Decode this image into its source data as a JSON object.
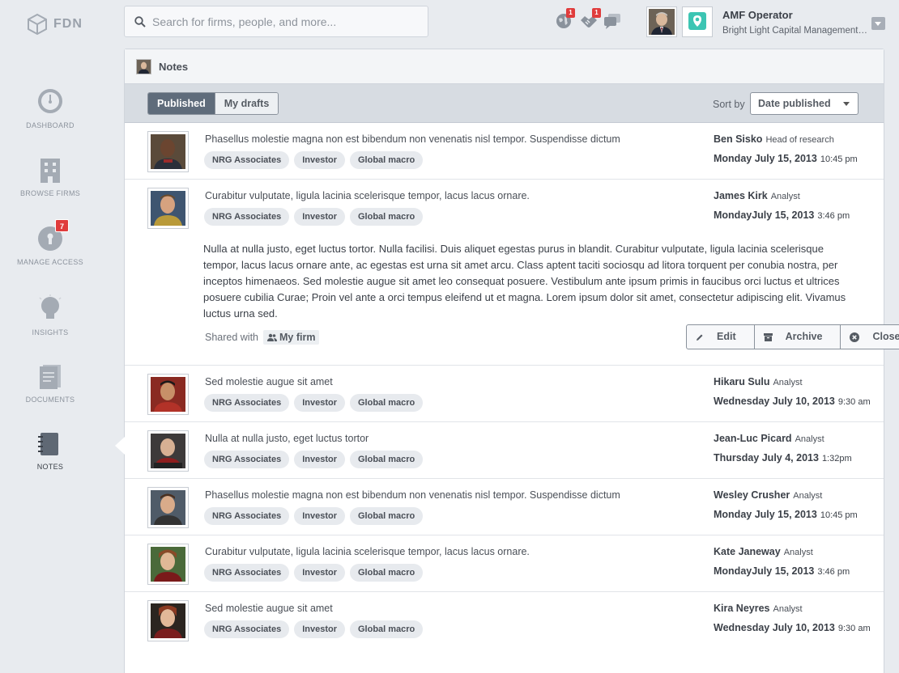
{
  "brand": {
    "name": "FDN"
  },
  "search": {
    "placeholder": "Search for firms, people, and more..."
  },
  "notifications": [
    {
      "icon": "globe-icon",
      "count": "1"
    },
    {
      "icon": "handshake-icon",
      "count": "1"
    },
    {
      "icon": "chat-bubbles-icon"
    }
  ],
  "user": {
    "name": "AMF Operator",
    "firm": "Bright Light Capital Management ..."
  },
  "sidebar": {
    "items": [
      {
        "label": "DASHBOARD",
        "icon": "dashboard-icon"
      },
      {
        "label": "BROWSE FIRMS",
        "icon": "building-icon"
      },
      {
        "label": "MANAGE ACCESS",
        "icon": "lock-icon",
        "badge": "7"
      },
      {
        "label": "INSIGHTS",
        "icon": "lightbulb-icon"
      },
      {
        "label": "DOCUMENTS",
        "icon": "documents-icon"
      },
      {
        "label": "NOTES",
        "icon": "notebook-icon",
        "active": true
      }
    ]
  },
  "panel": {
    "title": "Notes",
    "tabs": {
      "published": "Published",
      "drafts": "My drafts"
    },
    "sort": {
      "label": "Sort by",
      "value": "Date published"
    }
  },
  "tags": [
    "NRG Associates",
    "Investor",
    "Global macro"
  ],
  "notes": [
    {
      "title": "Phasellus molestie magna non est bibendum non venenatis nisl tempor. Suspendisse dictum",
      "author": "Ben Sisko",
      "role": "Head of research",
      "date": "Monday July 15, 2013",
      "time": "10:45 pm"
    },
    {
      "title": "Curabitur vulputate, ligula lacinia scelerisque tempor, lacus lacus ornare.",
      "author": "James Kirk",
      "role": "Analyst",
      "date": "MondayJuly 15, 2013",
      "time": "3:46 pm",
      "body": "Nulla at nulla justo, eget luctus tortor. Nulla facilisi. Duis aliquet egestas purus in blandit. Curabitur vulputate, ligula lacinia scelerisque tempor, lacus lacus ornare ante, ac egestas est urna sit amet arcu. Class aptent taciti sociosqu ad litora torquent per conubia nostra, per inceptos himenaeos. Sed molestie augue sit amet leo consequat posuere. Vestibulum ante ipsum primis in faucibus orci luctus et ultrices posuere cubilia Curae; Proin vel ante a orci tempus eleifend ut et magna. Lorem ipsum dolor sit amet, consectetur adipiscing elit. Vivamus luctus urna sed.",
      "shared_label": "Shared with",
      "shared_with": "My firm",
      "actions": {
        "edit": "Edit",
        "archive": "Archive",
        "close": "Close"
      }
    },
    {
      "title": "Sed molestie augue sit amet",
      "author": "Hikaru Sulu",
      "role": "Analyst",
      "date": "Wednesday July 10, 2013",
      "time": "9:30 am"
    },
    {
      "title": "Nulla at nulla justo, eget luctus tortor",
      "author": "Jean-Luc Picard",
      "role": "Analyst",
      "date": "Thursday July 4, 2013",
      "time": "1:32pm"
    },
    {
      "title": "Phasellus molestie magna non est bibendum non venenatis nisl tempor. Suspendisse dictum",
      "author": "Wesley Crusher",
      "role": "Analyst",
      "date": "Monday July 15, 2013",
      "time": "10:45 pm"
    },
    {
      "title": "Curabitur vulputate, ligula lacinia scelerisque tempor, lacus lacus ornare.",
      "author": "Kate Janeway",
      "role": "Analyst",
      "date": "MondayJuly 15, 2013",
      "time": "3:46 pm"
    },
    {
      "title": "Sed molestie augue sit amet",
      "author": "Kira Neyres",
      "role": "Analyst",
      "date": "Wednesday July 10, 2013",
      "time": "9:30 am"
    }
  ],
  "colors": {
    "accent": "#5f6c7b",
    "badge": "#e03c3c",
    "firm_logo": "#3cc5b3",
    "sidebar_bg": "#e8ebef"
  }
}
